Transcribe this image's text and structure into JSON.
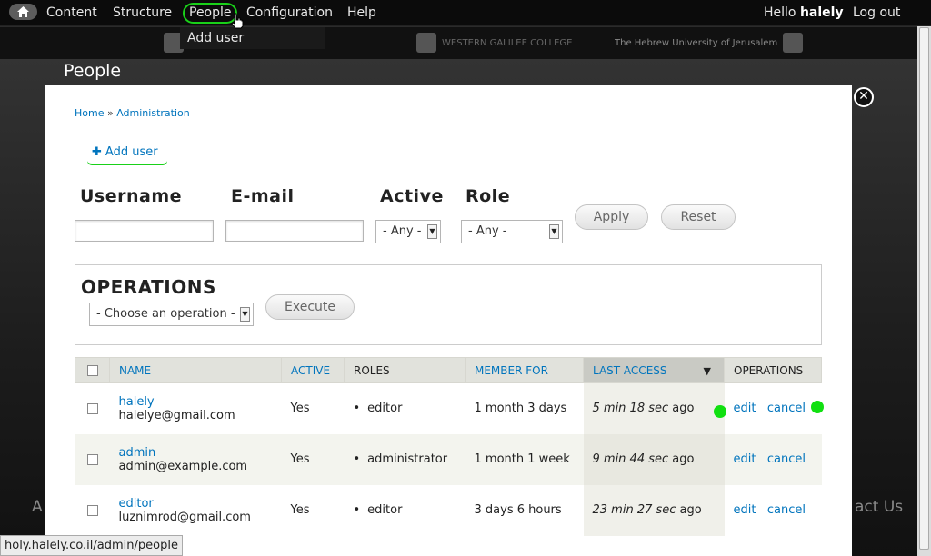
{
  "toolbar": {
    "menu": [
      "Content",
      "Structure",
      "People",
      "Configuration",
      "Help"
    ],
    "hello_prefix": "Hello ",
    "username": "halely",
    "logout": "Log out"
  },
  "dropdown": {
    "item": "Add user"
  },
  "background": {
    "left_text": "A",
    "right_text": "act Us"
  },
  "page": {
    "title": "People"
  },
  "modal": {
    "breadcrumb": [
      "Home",
      "Administration"
    ],
    "breadcrumb_sep": "»",
    "add_user": "Add user"
  },
  "filters": {
    "username_label": "Username",
    "email_label": "E-mail",
    "active_label": "Active",
    "role_label": "Role",
    "active_value": "- Any -",
    "role_value": "- Any -",
    "apply": "Apply",
    "reset": "Reset"
  },
  "operations": {
    "title": "OPERATIONS",
    "select_value": "- Choose an operation -",
    "execute": "Execute"
  },
  "table": {
    "headers": {
      "name": "NAME",
      "active": "ACTIVE",
      "roles": "ROLES",
      "member_for": "MEMBER FOR",
      "last_access": "LAST ACCESS",
      "operations": "OPERATIONS"
    },
    "rows": [
      {
        "name": "halely",
        "email": "halelye@gmail.com",
        "active": "Yes",
        "role": "editor",
        "member_for": "1 month 3 days",
        "last_access_time": "5 min 18 sec",
        "last_access_suffix": " ago",
        "edit": "edit",
        "cancel": "cancel"
      },
      {
        "name": "admin",
        "email": "admin@example.com",
        "active": "Yes",
        "role": "administrator",
        "member_for": "1 month 1 week",
        "last_access_time": "9 min 44 sec",
        "last_access_suffix": " ago",
        "edit": "edit",
        "cancel": "cancel"
      },
      {
        "name": "editor",
        "email": "luznimrod@gmail.com",
        "active": "Yes",
        "role": "editor",
        "member_for": "3 days 6 hours",
        "last_access_time": "23 min 27 sec",
        "last_access_suffix": " ago",
        "edit": "edit",
        "cancel": "cancel"
      }
    ]
  },
  "statusbar": {
    "url": "holy.halely.co.il/admin/people"
  },
  "header_logos": [
    "WESTERN GALILEE COLLEGE",
    "The Hebrew University of Jerusalem"
  ],
  "colors": {
    "link": "#0074bd",
    "annotation": "#19d119",
    "toolbar": "#0b0b0b"
  }
}
